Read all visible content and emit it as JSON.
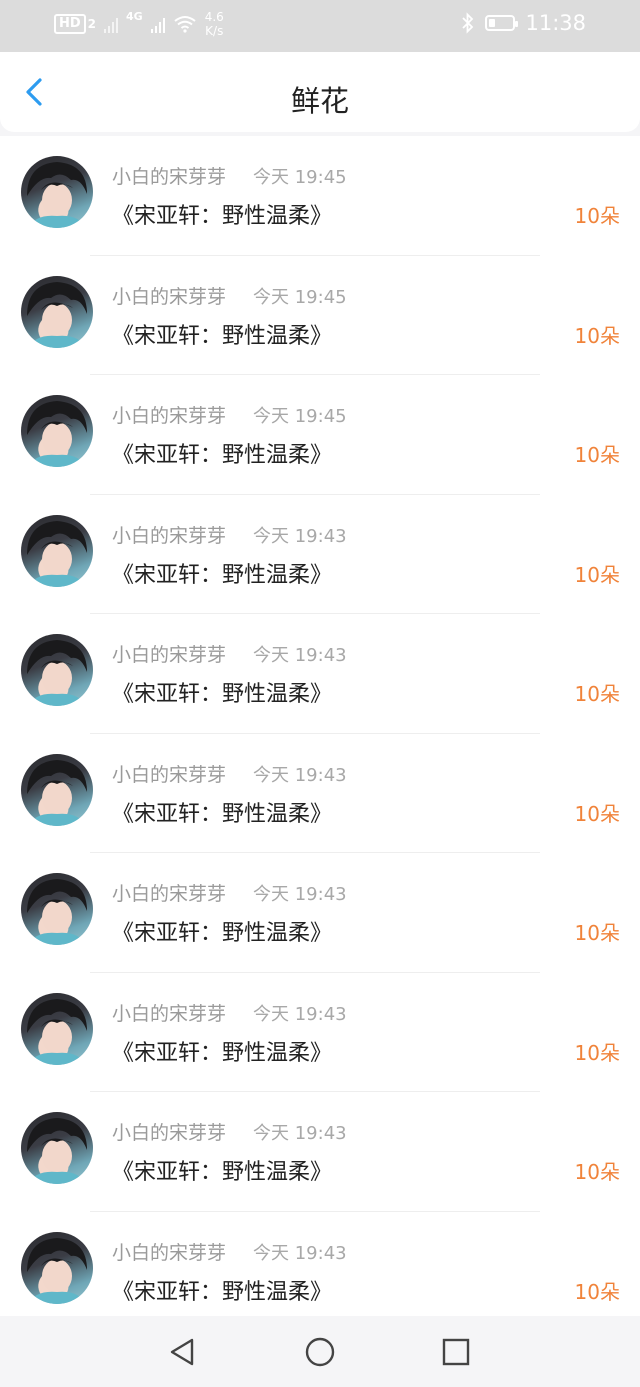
{
  "status_bar": {
    "hd_label": "HD",
    "sim_label": "2",
    "network_type": "4G",
    "net_speed_value": "4.6",
    "net_speed_unit": "K/s",
    "time": "11:38",
    "battery_level": 0.25
  },
  "header": {
    "title": "鲜花",
    "back_icon": "chevron-left-icon",
    "accent_color": "#2d9cf0"
  },
  "gifts": [
    {
      "user": "小白的宋芽芽",
      "time": "今天 19:45",
      "book": "《宋亚轩：野性温柔》",
      "amount": "10朵"
    },
    {
      "user": "小白的宋芽芽",
      "time": "今天 19:45",
      "book": "《宋亚轩：野性温柔》",
      "amount": "10朵"
    },
    {
      "user": "小白的宋芽芽",
      "time": "今天 19:45",
      "book": "《宋亚轩：野性温柔》",
      "amount": "10朵"
    },
    {
      "user": "小白的宋芽芽",
      "time": "今天 19:43",
      "book": "《宋亚轩：野性温柔》",
      "amount": "10朵"
    },
    {
      "user": "小白的宋芽芽",
      "time": "今天 19:43",
      "book": "《宋亚轩：野性温柔》",
      "amount": "10朵"
    },
    {
      "user": "小白的宋芽芽",
      "time": "今天 19:43",
      "book": "《宋亚轩：野性温柔》",
      "amount": "10朵"
    },
    {
      "user": "小白的宋芽芽",
      "time": "今天 19:43",
      "book": "《宋亚轩：野性温柔》",
      "amount": "10朵"
    },
    {
      "user": "小白的宋芽芽",
      "time": "今天 19:43",
      "book": "《宋亚轩：野性温柔》",
      "amount": "10朵"
    },
    {
      "user": "小白的宋芽芽",
      "time": "今天 19:43",
      "book": "《宋亚轩：野性温柔》",
      "amount": "10朵"
    },
    {
      "user": "小白的宋芽芽",
      "time": "今天 19:43",
      "book": "《宋亚轩：野性温柔》",
      "amount": "10朵"
    }
  ],
  "colors": {
    "amount": "#f0833a",
    "secondary_text": "#9a9a9a",
    "primary_text": "#222222"
  },
  "nav": {
    "back_icon": "triangle-back-icon",
    "home_icon": "circle-home-icon",
    "recents_icon": "square-recents-icon"
  }
}
